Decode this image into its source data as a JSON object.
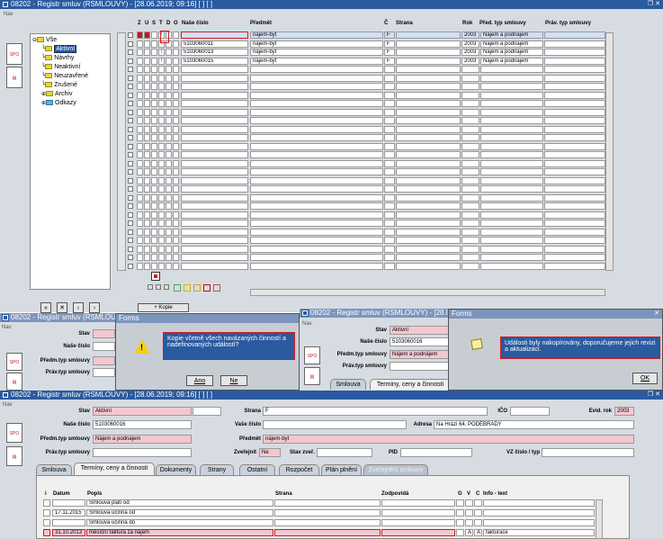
{
  "win1": {
    "title": "08202 - Registr smluv (RSMLOUVY) - [28.06.2019; 09:16] [ ] [ ]",
    "nav": "Nav"
  },
  "toolbar": {
    "spo": "SPO"
  },
  "tree": {
    "root": "Vše",
    "items": [
      "Aktivní",
      "Návrhy",
      "Neaktivní",
      "Neuzavřené",
      "Zrušené",
      "Archiv",
      "Odkazy"
    ]
  },
  "grid": {
    "flags": [
      "Z",
      "U",
      "S",
      "T",
      "D",
      "O"
    ],
    "headers": {
      "nase": "Naše číslo",
      "predmet": "Předmět",
      "c": "Č",
      "strana": "Strana",
      "rok": "Rok",
      "pred": "Před. typ smlouvy",
      "prav": "Práv. typ smlouvy"
    },
    "rows": [
      {
        "nase": "",
        "predmet": "nájem-byt",
        "c": "F",
        "rok": "2003",
        "pred": "Nájem a podnájem"
      },
      {
        "nase": "5103060011",
        "predmet": "nájem-byt",
        "c": "F",
        "rok": "2003",
        "pred": "Nájem a podnájem"
      },
      {
        "nase": "5103060013",
        "predmet": "nájem-byt",
        "c": "F",
        "rok": "2003",
        "pred": "Nájem a podnájem"
      },
      {
        "nase": "5103060015",
        "predmet": "nájem-byt",
        "c": "F",
        "rok": "2003",
        "pred": "Nájem a podnájem"
      }
    ],
    "kopie": "+ Kopie"
  },
  "mid_left": {
    "title": "08202 - Registr smluv (RSMLOUVY)",
    "stav": "Stav",
    "nase": "Naše číslo",
    "predm": "Předm.typ smlouvy",
    "prav": "Práv.typ smlouvy"
  },
  "dialog1": {
    "title": "Forms",
    "message": "Kopie včetně všech navázaných činností a nadefinovaných událostí?",
    "yes": "Ano",
    "no": "Ne"
  },
  "mid_right": {
    "title": "08202 - Registr smluv (RSMLOUVY) - [28.06.20",
    "nav": "Nav",
    "stav": "Stav",
    "stav_val": "Aktivní",
    "nase": "Naše číslo",
    "nase_val": "5103060016",
    "predm": "Předm.typ smlouvy",
    "predm_val": "Nájem a podnájem",
    "prav": "Práv.typ smlouvy",
    "tab1": "Smlouva",
    "tab2": "Terminy, ceny a činnosti"
  },
  "dialog2": {
    "title": "Forms",
    "message": "Události byly nakopírovány, doporučujeme jejich revizi a aktualizaci.",
    "ok": "OK"
  },
  "win3": {
    "title": "08202 - Registr smluv (RSMLOUVY) - [28.06.2019; 09:16] [ ] [ ]",
    "nav": "Nav",
    "stav": "Stav",
    "stav_val": "Aktivní",
    "strana": "Strana",
    "strana_val": "F",
    "ico": "IČO",
    "evid": "Evid. rok",
    "evid_val": "2003",
    "nase": "Naše číslo",
    "nase_val": "5103060016",
    "vase": "Vaše číslo",
    "adresa": "Adresa",
    "adresa_val": "Na Hrázi 64, PODĚBRADY",
    "predm": "Předm.typ smlouvy",
    "predm_val": "Nájem a podnájem",
    "predmet": "Předmět",
    "predmet_val": "nájem-byt",
    "prav": "Práv.typ smlouvy",
    "zver": "Zveřejnit",
    "zver_val": "Ne",
    "stav_zver": "Stav zveř.",
    "pid": "PID",
    "vz": "VZ číslo / typ",
    "tabs": [
      "Smlouva",
      "Termíny, ceny a činnosti",
      "Dokumenty",
      "Strany",
      "Ostatní",
      "Rozpočet",
      "Plán plnění",
      "Zveřejnění smlouvy"
    ],
    "cols": {
      "i": "i",
      "datum": "Datum",
      "popis": "Popis",
      "strana": "Strana",
      "zodp": "Zodpovídá",
      "g": "G",
      "v": "V",
      "c": "C",
      "info": "Info - text"
    },
    "rows": [
      {
        "datum": "",
        "popis": "Smlouva platí od",
        "v": "",
        "c": "",
        "info": ""
      },
      {
        "datum": "17.11.2015",
        "popis": "Smlouva účinná od",
        "v": "",
        "c": "",
        "info": ""
      },
      {
        "datum": "",
        "popis": "Smlouva účinná do",
        "v": "",
        "c": "",
        "info": ""
      },
      {
        "datum": "31.10.2013",
        "popis": "měsíční faktura za nájem",
        "v": "A",
        "c": "A",
        "info": "fakturace"
      }
    ]
  }
}
